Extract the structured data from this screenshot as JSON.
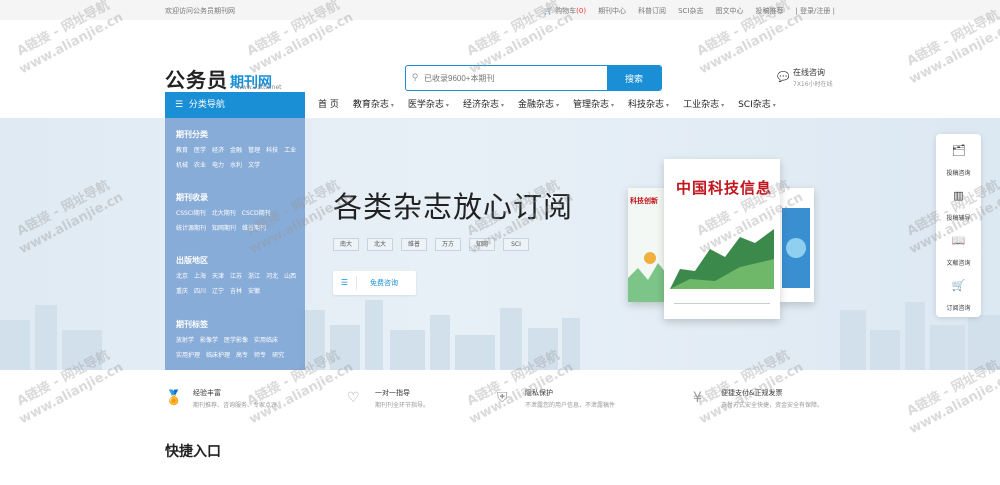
{
  "topbar": {
    "welcome": "欢迎访问公务员期刊网",
    "cart_label": "购物车",
    "cart_count": "(0)",
    "links": [
      "期刊中心",
      "科普订阅",
      "SCI杂志",
      "图文中心",
      "投稿推荐",
      "| 登录/注册 |"
    ]
  },
  "header": {
    "logo_main": "公务员",
    "logo_sub": "期刊网",
    "logo_url": "www.21ttw.net",
    "search_placeholder": "已收录9600+本期刊",
    "search_button": "搜索",
    "consult_title": "在线咨询",
    "consult_sub": "7X16小时在线"
  },
  "nav": {
    "category": "分类导航",
    "items": [
      {
        "label": "首 页",
        "caret": false
      },
      {
        "label": "教育杂志",
        "caret": true
      },
      {
        "label": "医学杂志",
        "caret": true
      },
      {
        "label": "经济杂志",
        "caret": true
      },
      {
        "label": "金融杂志",
        "caret": true
      },
      {
        "label": "管理杂志",
        "caret": true
      },
      {
        "label": "科技杂志",
        "caret": true
      },
      {
        "label": "工业杂志",
        "caret": true
      },
      {
        "label": "SCI杂志",
        "caret": true
      }
    ]
  },
  "sidebar": {
    "sections": [
      {
        "title": "期刊分类",
        "items": [
          "教育",
          "医学",
          "经济",
          "金融",
          "管理",
          "科技",
          "工业",
          "机械",
          "农业",
          "电力",
          "水利",
          "文学"
        ]
      },
      {
        "title": "期刊收录",
        "items": [
          "CSSCI期刊",
          "北大期刊",
          "CSCD期刊",
          "统计源期刊",
          "知网期刊",
          "维普期刊"
        ]
      },
      {
        "title": "出版地区",
        "items": [
          "北京",
          "上海",
          "天津",
          "江苏",
          "浙江",
          "河北",
          "山西",
          "重庆",
          "四川",
          "辽宁",
          "吉林",
          "安徽"
        ]
      },
      {
        "title": "期刊标签",
        "items": [
          "放射学",
          "影像学",
          "医学影像",
          "实用临床",
          "实用护理",
          "临床护理",
          "高专",
          "师专",
          "研究"
        ]
      }
    ]
  },
  "banner": {
    "headline": "各类杂志放心订阅",
    "tags": [
      "南大",
      "北大",
      "维普",
      "万方",
      "知网",
      "SCI"
    ],
    "cta": "免费咨询",
    "magazine_title": "中国科技信息",
    "magazine_side_title": "科技创新"
  },
  "float_bar": [
    {
      "label": "投稿咨询",
      "icon": "inbox-icon"
    },
    {
      "label": "投稿辅导",
      "icon": "books-icon"
    },
    {
      "label": "文献咨询",
      "icon": "book-open-icon"
    },
    {
      "label": "订阅咨询",
      "icon": "cart-icon"
    }
  ],
  "features": [
    {
      "title": "经验丰富",
      "desc": "期刊推荐、咨询服务、专家点评",
      "icon": "medal-icon"
    },
    {
      "title": "一对一指导",
      "desc": "期刊刊全环节指导。",
      "icon": "heart-hand-icon"
    },
    {
      "title": "隐私保护",
      "desc": "不泄露您的用户信息，不泄露稿件",
      "icon": "shield-icon"
    },
    {
      "title": "便捷支付&正规发票",
      "desc": "支付方式安全快捷，资金安全有保障。",
      "icon": "coin-icon"
    }
  ],
  "quick_entry": "快捷入口",
  "watermark": {
    "line1": "A链接 - 网址导航",
    "line2": "www.alianjie.cn"
  }
}
